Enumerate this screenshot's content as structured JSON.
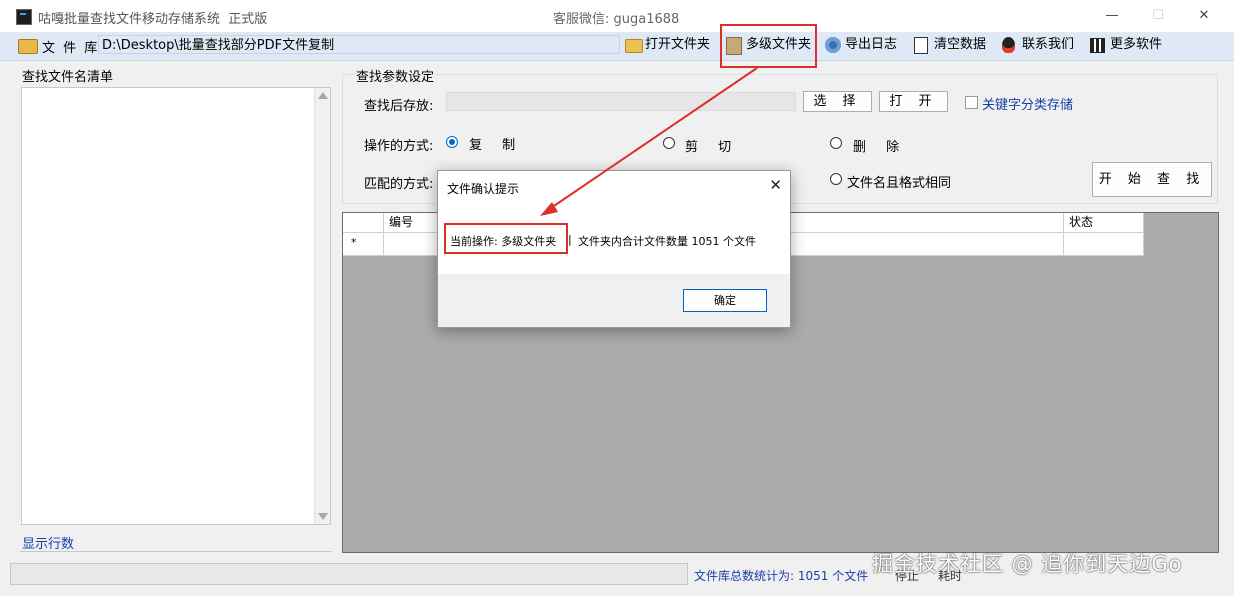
{
  "window": {
    "title": "咕嘎批量查找文件移动存储系统  正式版",
    "support": "客服微信: guga1688",
    "minimize": "—",
    "maximize": "☐",
    "close": "✕"
  },
  "toolbar": {
    "library_label": "文 件 库",
    "path": "D:\\Desktop\\批量查找部分PDF文件复制",
    "buttons": [
      {
        "label": "打开文件夹",
        "icon": "folder-icon"
      },
      {
        "label": "多级文件夹",
        "icon": "book-icon"
      },
      {
        "label": "导出日志",
        "icon": "gear-icon"
      },
      {
        "label": "清空数据",
        "icon": "clipboard-icon"
      },
      {
        "label": "联系我们",
        "icon": "penguin-icon"
      },
      {
        "label": "更多软件",
        "icon": "qr-code-icon"
      }
    ]
  },
  "left_panel": {
    "title": "查找文件名清单",
    "row_count_label": "显示行数"
  },
  "params": {
    "title": "查找参数设定",
    "dest_label": "查找后存放:",
    "dest_value": "",
    "select_button": "选 择",
    "open_button": "打 开",
    "keyword_checkbox": "关键字分类存储",
    "op_label": "操作的方式:",
    "op_options": [
      "复 制",
      "剪 切",
      "删 除"
    ],
    "op_selected": 0,
    "match_label": "匹配的方式:",
    "match_option_visible": "文件名且格式相同",
    "start_button": "开 始 查 找"
  },
  "grid": {
    "columns": [
      "编号",
      "状态"
    ],
    "new_row_marker": "*"
  },
  "status": {
    "total": "文件库总数统计为: 1051 个文件",
    "stop": "停止",
    "time": "耗时"
  },
  "watermark": "掘金技术社区 @ 追你到天边Go",
  "dialog": {
    "title": "文件确认提示",
    "close": "✕",
    "operation": "当前操作: 多级文件夹",
    "separator": "|",
    "info": "文件夹内合计文件数量 1051 个文件",
    "ok": "确定"
  },
  "colors": {
    "accent": "#0067c0",
    "highlight": "#d9302a",
    "link_blue": "#1a3ea8"
  }
}
